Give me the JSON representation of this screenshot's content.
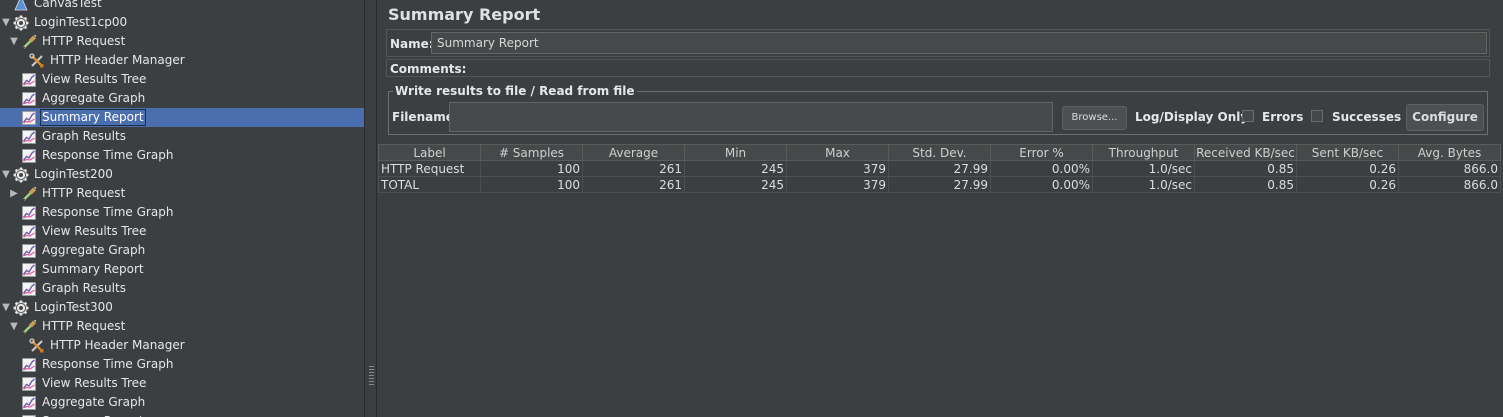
{
  "tree": {
    "items": [
      {
        "label": "CanvasTest",
        "icon": "flask-icon",
        "toggle": "",
        "indent": 0
      },
      {
        "label": "LoginTest1cp00",
        "icon": "gear-icon",
        "toggle": "expanded",
        "indent": 0
      },
      {
        "label": "HTTP Request",
        "icon": "pipette-icon",
        "toggle": "expanded",
        "indent": 1
      },
      {
        "label": "HTTP Header Manager",
        "icon": "tools-icon",
        "toggle": "",
        "indent": 2
      },
      {
        "label": "View Results Tree",
        "icon": "graph-icon",
        "toggle": "",
        "indent": 1
      },
      {
        "label": "Aggregate Graph",
        "icon": "graph-icon",
        "toggle": "",
        "indent": 1
      },
      {
        "label": "Summary Report",
        "icon": "graph-icon",
        "toggle": "",
        "indent": 1,
        "selected": true
      },
      {
        "label": "Graph Results",
        "icon": "graph-icon",
        "toggle": "",
        "indent": 1
      },
      {
        "label": "Response Time Graph",
        "icon": "graph-icon",
        "toggle": "",
        "indent": 1
      },
      {
        "label": "LoginTest200",
        "icon": "gear-icon",
        "toggle": "expanded",
        "indent": 0
      },
      {
        "label": "HTTP Request",
        "icon": "pipette-icon",
        "toggle": "collapsed",
        "indent": 1
      },
      {
        "label": "Response Time Graph",
        "icon": "graph-icon",
        "toggle": "",
        "indent": 1
      },
      {
        "label": "View Results Tree",
        "icon": "graph-icon",
        "toggle": "",
        "indent": 1
      },
      {
        "label": "Aggregate Graph",
        "icon": "graph-icon",
        "toggle": "",
        "indent": 1
      },
      {
        "label": "Summary Report",
        "icon": "graph-icon",
        "toggle": "",
        "indent": 1
      },
      {
        "label": "Graph Results",
        "icon": "graph-icon",
        "toggle": "",
        "indent": 1
      },
      {
        "label": "LoginTest300",
        "icon": "gear-icon",
        "toggle": "expanded",
        "indent": 0
      },
      {
        "label": "HTTP Request",
        "icon": "pipette-icon",
        "toggle": "expanded",
        "indent": 1
      },
      {
        "label": "HTTP Header Manager",
        "icon": "tools-icon",
        "toggle": "",
        "indent": 2
      },
      {
        "label": "Response Time Graph",
        "icon": "graph-icon",
        "toggle": "",
        "indent": 1
      },
      {
        "label": "View Results Tree",
        "icon": "graph-icon",
        "toggle": "",
        "indent": 1
      },
      {
        "label": "Aggregate Graph",
        "icon": "graph-icon",
        "toggle": "",
        "indent": 1
      },
      {
        "label": "Summary Report",
        "icon": "graph-icon",
        "toggle": "",
        "indent": 1
      }
    ]
  },
  "panel": {
    "title": "Summary Report",
    "name_label": "Name:",
    "name_value": "Summary Report",
    "comments_label": "Comments:",
    "file_group_title": "Write results to file / Read from file",
    "filename_label": "Filename",
    "filename_value": "",
    "browse_label": "Browse...",
    "log_display_label": "Log/Display Only:",
    "errors_label": "Errors",
    "errors_checked": false,
    "successes_label": "Successes",
    "successes_checked": false,
    "configure_label": "Configure"
  },
  "table": {
    "columns": [
      "Label",
      "# Samples",
      "Average",
      "Min",
      "Max",
      "Std. Dev.",
      "Error %",
      "Throughput",
      "Received KB/sec",
      "Sent KB/sec",
      "Avg. Bytes"
    ],
    "rows": [
      [
        "HTTP Request",
        "100",
        "261",
        "245",
        "379",
        "27.99",
        "0.00%",
        "1.0/sec",
        "0.85",
        "0.26",
        "866.0"
      ],
      [
        "TOTAL",
        "100",
        "261",
        "245",
        "379",
        "27.99",
        "0.00%",
        "1.0/sec",
        "0.85",
        "0.26",
        "866.0"
      ]
    ]
  },
  "colors": {
    "background": "#3c3f41",
    "selection": "#4b6eaf",
    "text": "#dcdcdc"
  }
}
